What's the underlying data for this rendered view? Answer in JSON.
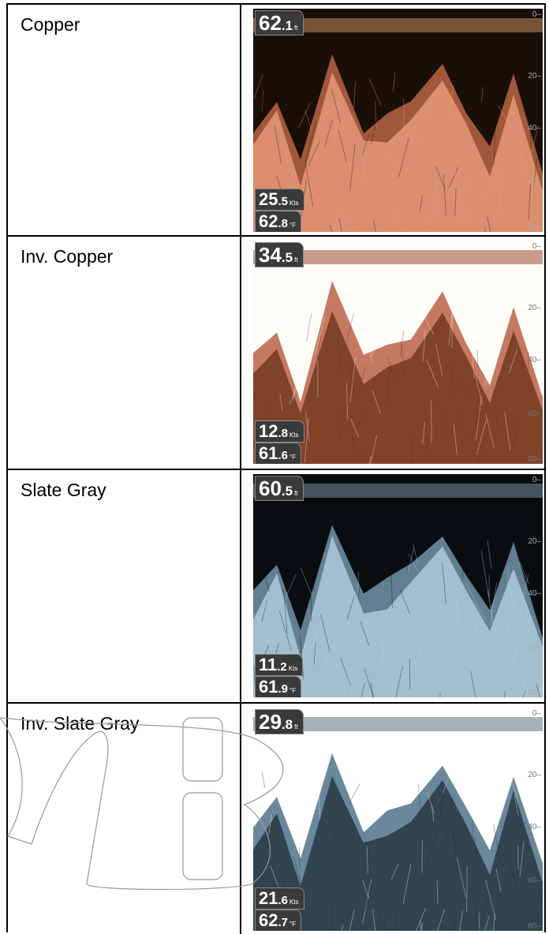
{
  "rows": [
    {
      "label": "Copper",
      "depth_whole": "62",
      "depth_frac": ".1",
      "depth_unit": "ft",
      "speed_whole": "25",
      "speed_frac": ".5",
      "speed_unit": "Kts",
      "temp_whole": "62",
      "temp_frac": ".8",
      "temp_unit": "°F",
      "palette": {
        "bg": "#1a0e08",
        "fg": "#f0a080",
        "mid": "#b06040",
        "surface": "#a07050"
      },
      "scale": [
        "0",
        "20",
        "40",
        "60",
        "80"
      ]
    },
    {
      "label": "Inv. Copper",
      "depth_whole": "34",
      "depth_frac": ".5",
      "depth_unit": "ft",
      "speed_whole": "12",
      "speed_frac": ".8",
      "speed_unit": "Kts",
      "temp_whole": "61",
      "temp_frac": ".6",
      "temp_unit": "°F",
      "palette": {
        "bg": "#fffdf8",
        "fg": "#6a3018",
        "mid": "#c06a50",
        "surface": "#b07060"
      },
      "scale": [
        "0",
        "20",
        "40",
        "60",
        "80"
      ]
    },
    {
      "label": "Slate Gray",
      "depth_whole": "60",
      "depth_frac": ".5",
      "depth_unit": "ft",
      "speed_whole": "11",
      "speed_frac": ".2",
      "speed_unit": "Kts",
      "temp_whole": "61",
      "temp_frac": ".9",
      "temp_unit": "°F",
      "palette": {
        "bg": "#0a0d10",
        "fg": "#b8d4e4",
        "mid": "#6a8ca0",
        "surface": "#607080"
      },
      "scale": [
        "0",
        "20",
        "40",
        "60",
        "80"
      ]
    },
    {
      "label": "Inv. Slate Gray",
      "depth_whole": "29",
      "depth_frac": ".8",
      "depth_unit": "ft",
      "speed_whole": "21",
      "speed_frac": ".6",
      "speed_unit": "Kts",
      "temp_whole": "62",
      "temp_frac": ".7",
      "temp_unit": "°F",
      "palette": {
        "bg": "#ffffff",
        "fg": "#1e2e3a",
        "mid": "#5a7a90",
        "surface": "#7a90a0"
      },
      "scale": [
        "0",
        "20",
        "40",
        "60",
        "80"
      ]
    }
  ]
}
